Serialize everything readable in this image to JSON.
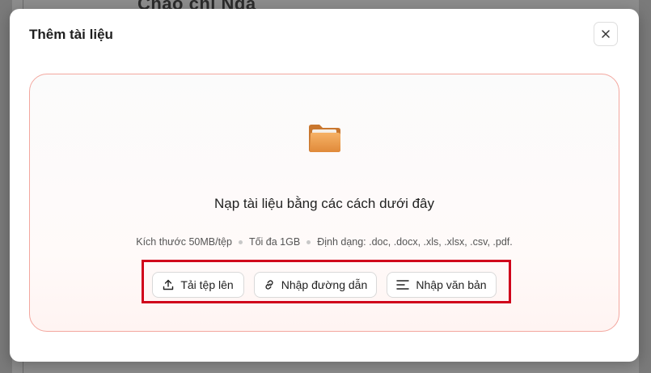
{
  "background": {
    "heading": "Chào chị Nga"
  },
  "modal": {
    "title": "Thêm tài liệu",
    "close_icon": "close-icon",
    "dropzone": {
      "folder_icon": "folder-icon",
      "title": "Nạp tài liệu bằng các cách dưới đây",
      "info": {
        "size": "Kích thước 50MB/tệp",
        "max": "Tối đa 1GB",
        "formats": "Định dạng: .doc, .docx, .xls, .xlsx, .csv, .pdf."
      },
      "buttons": {
        "upload": {
          "label": "Tải tệp lên",
          "icon": "upload-icon"
        },
        "link": {
          "label": "Nhập đường dẫn",
          "icon": "link-icon"
        },
        "text": {
          "label": "Nhập văn bản",
          "icon": "text-lines-icon"
        }
      }
    }
  },
  "colors": {
    "accent_border": "#f3a79f",
    "highlight": "#d0021b",
    "folder": "#f0a050"
  }
}
